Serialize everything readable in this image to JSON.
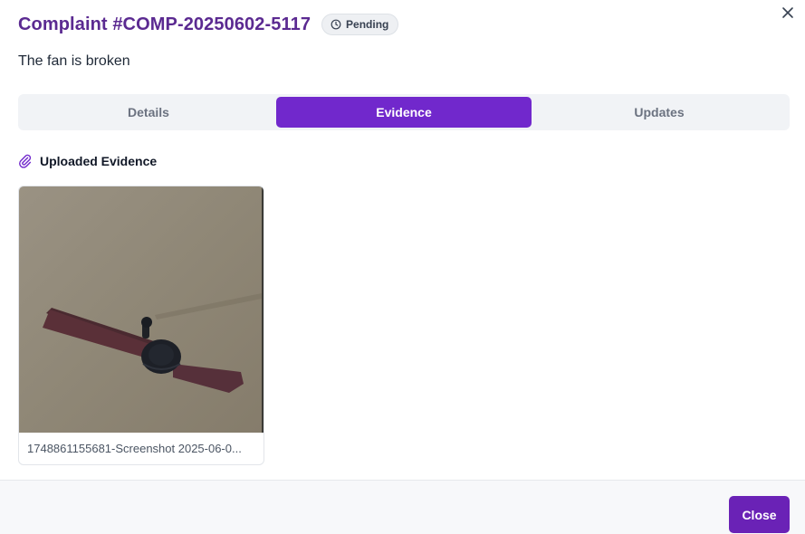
{
  "complaint": {
    "title": "Complaint #COMP-20250602-5117",
    "status": "Pending",
    "subject": "The fan is broken"
  },
  "tabs": [
    {
      "label": "Details",
      "active": false
    },
    {
      "label": "Evidence",
      "active": true
    },
    {
      "label": "Updates",
      "active": false
    }
  ],
  "evidence": {
    "heading": "Uploaded Evidence",
    "files": [
      {
        "name": "1748861155681-Screenshot 2025-06-0...",
        "image": "ceiling fan photo"
      }
    ]
  },
  "footer": {
    "close_label": "Close"
  },
  "icons": {
    "dialog_close": "close-icon",
    "status": "clock-icon",
    "evidence": "paperclip-icon"
  },
  "colors": {
    "accent": "#7128cc",
    "title": "#5b2a91",
    "button": "#6a22b6"
  }
}
